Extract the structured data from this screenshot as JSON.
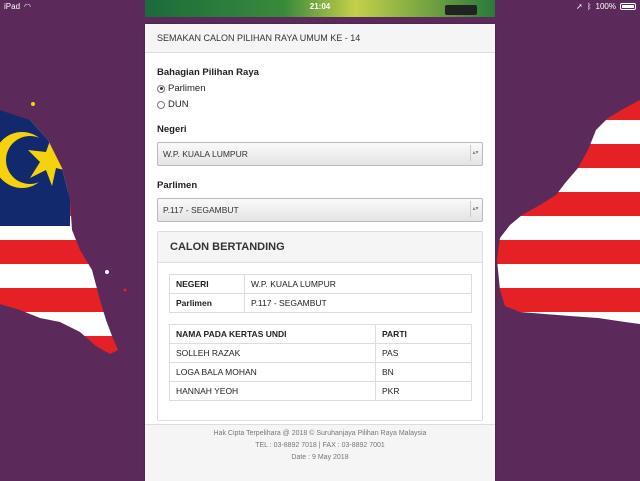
{
  "statusbar": {
    "device": "iPad",
    "time": "21:04",
    "battery": "100%"
  },
  "colors": {
    "background": "#5b2a5a",
    "flag_red": "#e62126",
    "flag_blue": "#12296d",
    "flag_yellow": "#f5d20b"
  },
  "form": {
    "header": "SEMAKAN CALON PILIHAN RAYA UMUM KE - 14",
    "bahagian_label": "Bahagian Pilihan Raya",
    "radio_options": [
      {
        "label": "Parlimen",
        "checked": true
      },
      {
        "label": "DUN",
        "checked": false
      }
    ],
    "negeri_label": "Negeri",
    "negeri_value": "W.P. KUALA LUMPUR",
    "parlimen_label": "Parlimen",
    "parlimen_value": "P.117 - SEGAMBUT"
  },
  "results": {
    "title": "CALON BERTANDING",
    "info": [
      {
        "key": "NEGERI",
        "value": "W.P. KUALA LUMPUR"
      },
      {
        "key": "Parlimen",
        "value": "P.117 - SEGAMBUT"
      }
    ],
    "columns": [
      "NAMA PADA KERTAS UNDI",
      "PARTI"
    ],
    "candidates": [
      {
        "name": "SOLLEH RAZAK",
        "party": "PAS"
      },
      {
        "name": "LOGA BALA MOHAN",
        "party": "BN"
      },
      {
        "name": "HANNAH YEOH",
        "party": "PKR"
      }
    ]
  },
  "footer": {
    "copyright": "Hak Cipta Terpelihara @ 2018 © Suruhanjaya Pilihan Raya Malaysia",
    "contact": "TEL : 03-8892 7018 | FAX : 03-8892 7001",
    "date": "Date : 9 May 2018"
  }
}
